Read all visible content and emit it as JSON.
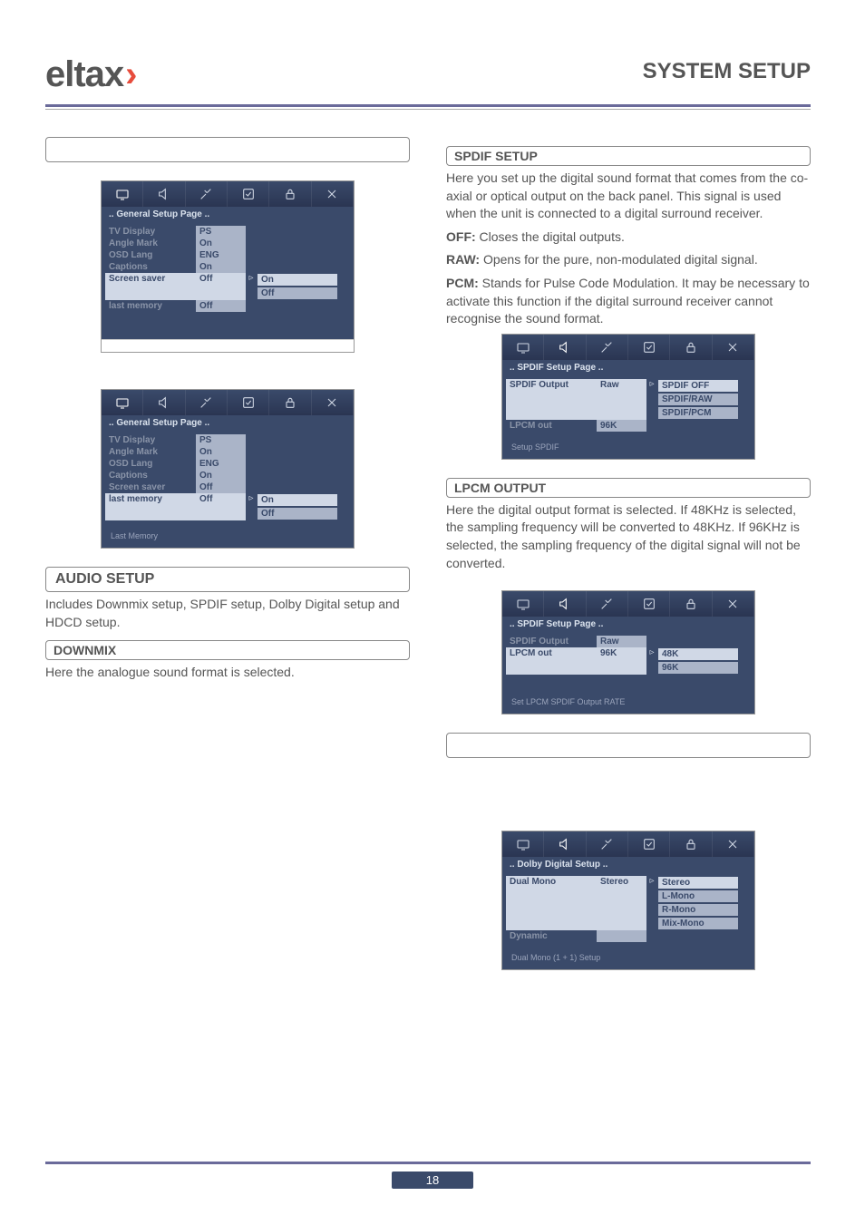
{
  "brand": "eltax",
  "page_title": "SYSTEM SETUP",
  "page_number": "18",
  "left": {
    "audio_setup": {
      "heading": "AUDIO SETUP",
      "text": "Includes Downmix setup, SPDIF setup, Dolby Digital setup and HDCD setup."
    },
    "downmix": {
      "heading": "DOWNMIX",
      "text": "Here the analogue sound format is selected."
    }
  },
  "right": {
    "spdif_heading": "SPDIF SETUP",
    "spdif_intro": "Here you set up the digital sound format that comes from the co-axial or optical output on the back panel.  This signal is used when the unit is connected to a digital surround receiver.",
    "spdif_off_label": "OFF:",
    "spdif_off_text": " Closes the digital outputs.",
    "spdif_raw_label": "RAW:",
    "spdif_raw_text": " Opens for the pure, non-modulated digital signal.",
    "spdif_pcm_label": "PCM:",
    "spdif_pcm_text": " Stands for Pulse Code Modulation. It may be necessary to activate this function if the digital surround receiver cannot recognise the sound format.",
    "lpcm_heading": "LPCM OUTPUT",
    "lpcm_text": "Here the digital output format is selected. If 48KHz is selected, the sampling frequency will be converted to 48KHz. If  96KHz is selected, the sampling frequency of the digital signal will not be converted."
  },
  "osd": {
    "general_title": ".. General Setup Page ..",
    "general_rows": {
      "tv_display": "TV  Display",
      "angle_mark": "Angle Mark",
      "osd_lang": "OSD  Lang",
      "captions": "Captions",
      "screen_saver": "Screen saver",
      "last_memory": "last  memory"
    },
    "general_vals": {
      "ps": "PS",
      "on": "On",
      "eng": "ENG",
      "off": "Off"
    },
    "general_sub": {
      "on": "On",
      "off": "Off"
    },
    "general_footer": "Last Memory",
    "spdif_title": ".. SPDIF Setup Page ..",
    "spdif_rows": {
      "spdif_output": "SPDIF  Output",
      "lpcm_out": "LPCM  out"
    },
    "spdif_vals": {
      "raw": "Raw",
      "k96": "96K"
    },
    "spdif_sub": {
      "off": "SPDIF  OFF",
      "raw": "SPDIF/RAW",
      "pcm": "SPDIF/PCM"
    },
    "spdif_footer": "Setup  SPDIF",
    "lpcm_sub": {
      "k48": "48K",
      "k96": "96K"
    },
    "lpcm_footer": "Set  LPCM  SPDIF  Output RATE",
    "dolby_title": ".. Dolby Digital  Setup  ..",
    "dolby_rows": {
      "dual_mono": "Dual  Mono",
      "dynamic": "Dynamic"
    },
    "dolby_vals": {
      "stereo": "Stereo"
    },
    "dolby_sub": {
      "stereo": "Stereo",
      "lmono": "L-Mono",
      "rmono": "R-Mono",
      "mixmono": "Mix-Mono"
    },
    "dolby_footer": "Dual  Mono  (1 + 1)  Setup"
  },
  "icons": {
    "tv": "tv-icon",
    "speaker": "speaker-icon",
    "tools": "tools-icon",
    "check": "check-icon",
    "lock": "lock-icon",
    "close": "close-icon"
  }
}
